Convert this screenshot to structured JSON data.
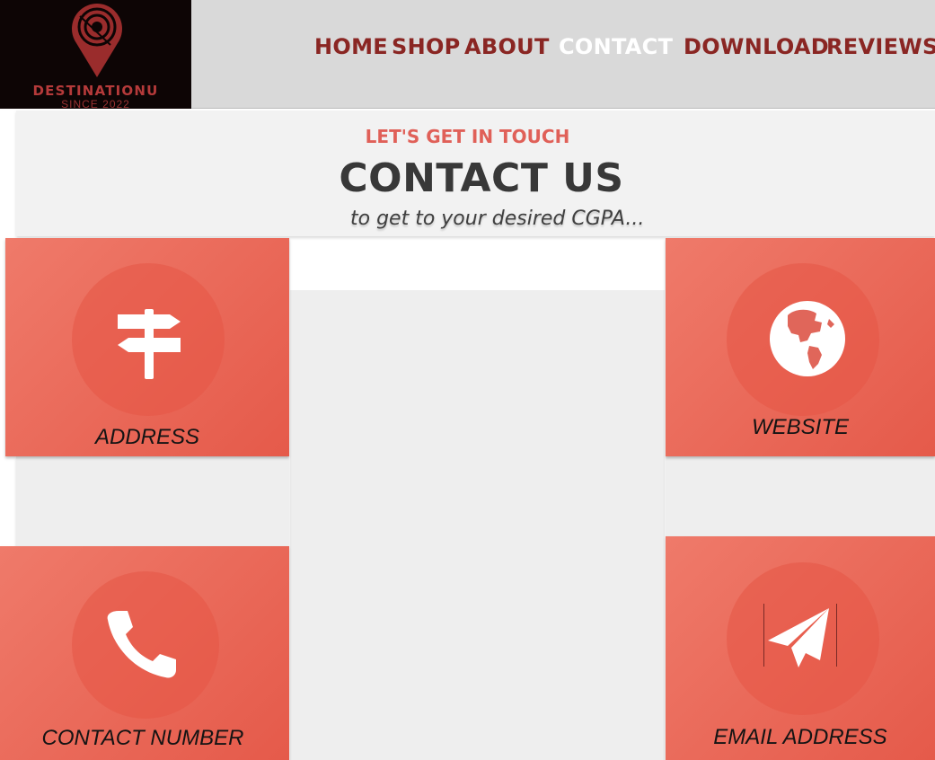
{
  "brand": {
    "name": "DESTINATIONU",
    "since": "SINCE 2022"
  },
  "nav": {
    "items": [
      {
        "label": "HOME"
      },
      {
        "label": "SHOP"
      },
      {
        "label": "ABOUT"
      },
      {
        "label": "CONTACT",
        "active": true
      },
      {
        "label": "DOWNLOAD"
      },
      {
        "label": "REVIEWS"
      }
    ]
  },
  "intro": {
    "eyebrow": "LET'S GET IN TOUCH",
    "title": "CONTACT US",
    "subtitle": "to get to your desired CGPA..."
  },
  "cards": {
    "address": {
      "label": "ADDRESS",
      "icon": "signpost-icon"
    },
    "website": {
      "label": "WEBSITE",
      "icon": "globe-icon"
    },
    "phone": {
      "label": "CONTACT NUMBER",
      "icon": "phone-icon"
    },
    "email": {
      "label": "EMAIL ADDRESS",
      "icon": "paper-plane-icon"
    }
  },
  "colors": {
    "accent": "#e55a4a",
    "nav_text": "#8a2623",
    "nav_active": "#ffffff",
    "header_bg": "#d9d9d9",
    "logo_bg": "#0d0505"
  }
}
